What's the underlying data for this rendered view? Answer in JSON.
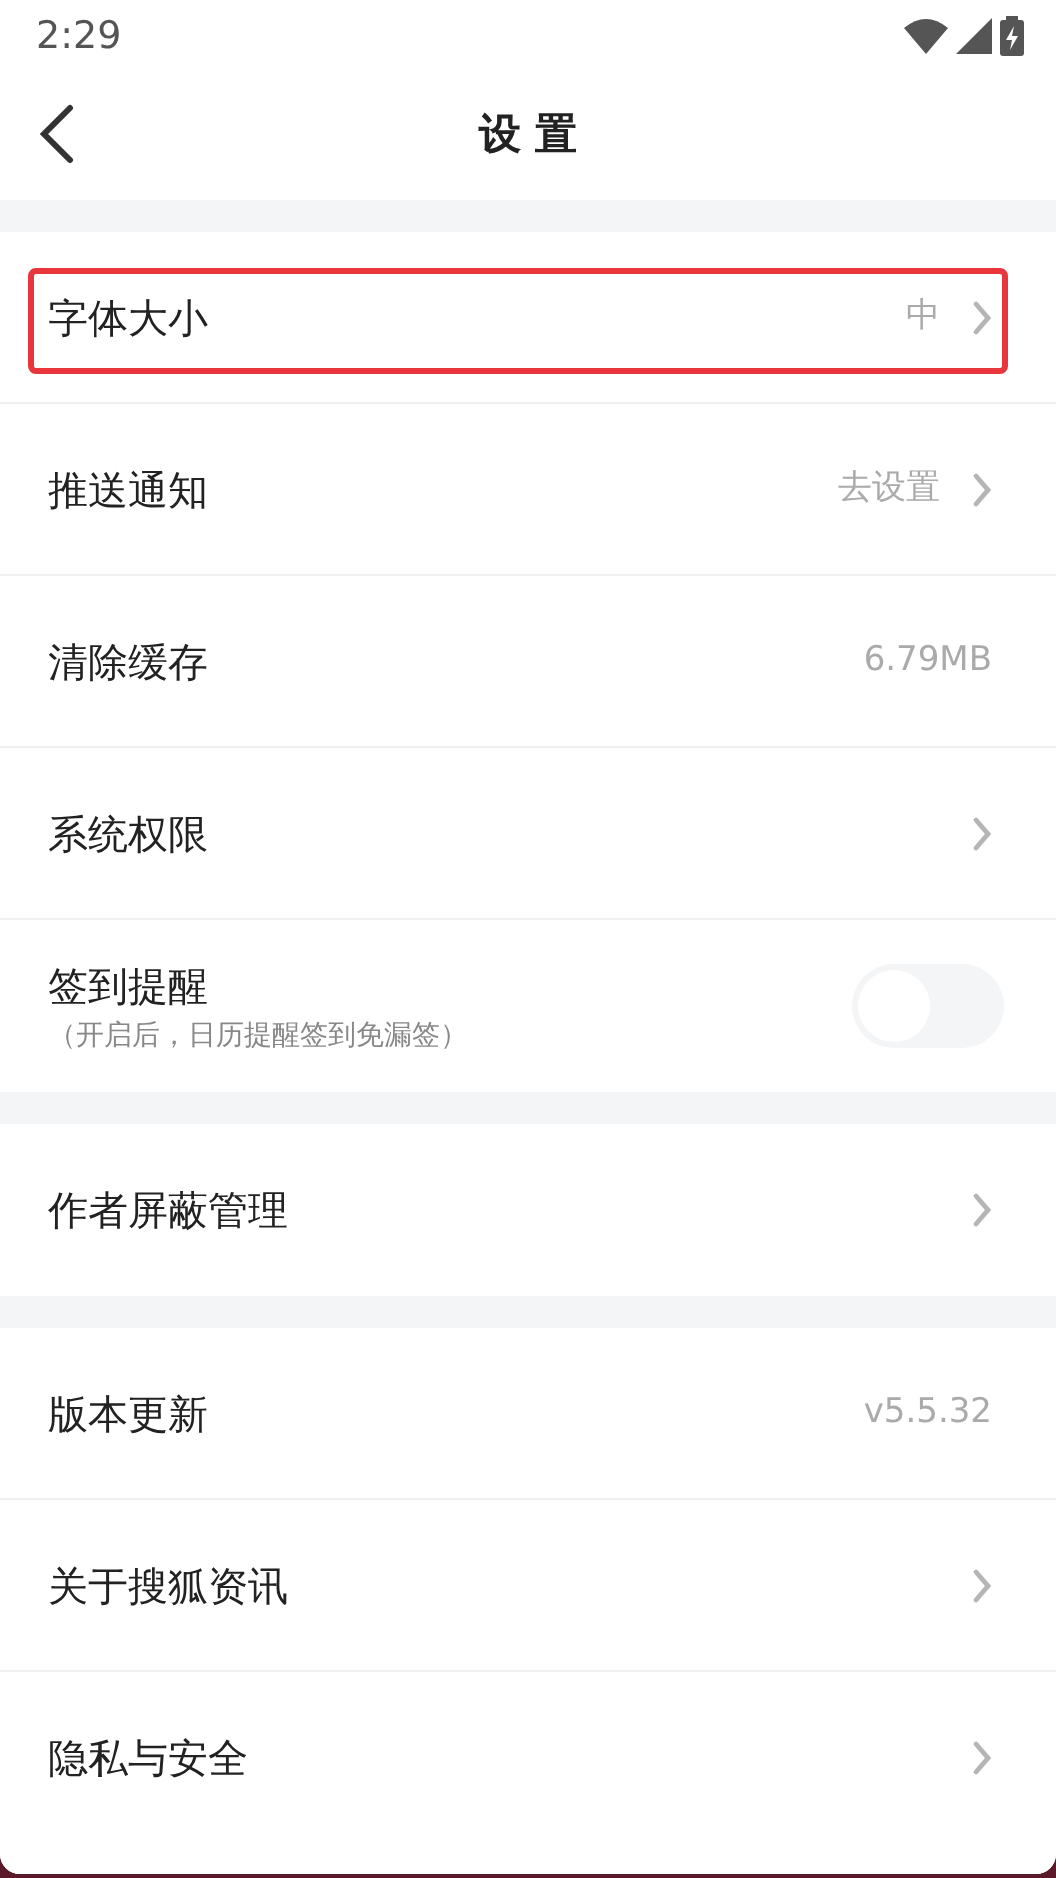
{
  "status_bar": {
    "time": "2:29"
  },
  "header": {
    "title": "设 置"
  },
  "sections": [
    {
      "items": [
        {
          "kind": "link",
          "label": "字体大小",
          "value": "中",
          "highlighted": true
        },
        {
          "kind": "link",
          "label": "推送通知",
          "value": "去设置",
          "highlighted": false
        },
        {
          "kind": "info",
          "label": "清除缓存",
          "value": "6.79MB",
          "highlighted": false
        },
        {
          "kind": "link",
          "label": "系统权限",
          "highlighted": false
        },
        {
          "kind": "toggle",
          "label": "签到提醒",
          "subtitle": "（开启后，日历提醒签到免漏签）",
          "on": false,
          "highlighted": false
        }
      ]
    },
    {
      "items": [
        {
          "kind": "link",
          "label": "作者屏蔽管理",
          "highlighted": false
        }
      ]
    },
    {
      "items": [
        {
          "kind": "info",
          "label": "版本更新",
          "value": "v5.5.32",
          "highlighted": false
        },
        {
          "kind": "link",
          "label": "关于搜狐资讯",
          "highlighted": false
        },
        {
          "kind": "link",
          "label": "隐私与安全",
          "highlighted": false
        }
      ]
    }
  ]
}
